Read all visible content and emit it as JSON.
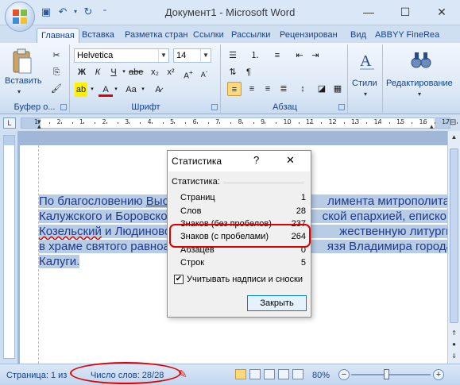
{
  "window": {
    "title": "Документ1 - Microsoft Word",
    "minimize_icon": "—",
    "maximize_icon": "☐",
    "close_icon": "✕"
  },
  "tabs": [
    {
      "label": "Главная",
      "active": true
    },
    {
      "label": "Вставка"
    },
    {
      "label": "Разметка стран"
    },
    {
      "label": "Ссылки"
    },
    {
      "label": "Рассылки"
    },
    {
      "label": "Рецензирован"
    },
    {
      "label": "Вид"
    },
    {
      "label": "ABBYY FineRea"
    }
  ],
  "ribbon": {
    "clipboard": {
      "paste_label": "Вставить",
      "group_label": "Буфер о..."
    },
    "font": {
      "name": "Helvetica",
      "size": "14",
      "group_label": "Шрифт"
    },
    "paragraph": {
      "group_label": "Абзац"
    },
    "styles": {
      "label": "Стили"
    },
    "editing": {
      "label": "Редактирование"
    }
  },
  "ruler": {
    "numbers": [
      "1",
      "2",
      "1",
      "2",
      "3",
      "4",
      "5",
      "6",
      "7",
      "8",
      "9",
      "10",
      "11",
      "12",
      "13",
      "14",
      "15",
      "16",
      "17"
    ]
  },
  "document": {
    "lines": [
      {
        "hl": "По благословению ",
        "u": "Выс",
        "hidden": "",
        "r1": "лимента",
        "r2": " митрополита"
      },
      {
        "hl": "Калужского и Боровско",
        "u": "",
        "hidden": "",
        "r1": "ской епархией, ",
        "r2": "епископ"
      },
      {
        "hl": "",
        "u": "Козельский",
        "m": " и ",
        "u2": "Людиново",
        "r1": "жественную литургию"
      },
      {
        "hl": "в храме святого равноа",
        "u": "",
        "hidden": "",
        "r1": "язя Владимира город",
        "r2": ""
      },
      {
        "hl": "Калуги.",
        "u": "",
        "hidden": "",
        "r1": "",
        "r2": ""
      }
    ],
    "line_texts": [
      [
        "По благословению ",
        "Выс",
        "",
        "лимента митрополита"
      ],
      [
        "Калужского и Боровско",
        "",
        "",
        "ской епархией, епископ"
      ],
      [
        "",
        "Козельский",
        " и Людиново",
        "жественную литургию"
      ],
      [
        "в храме святого равноа",
        "",
        "",
        "язя Владимира города"
      ],
      [
        "Калуги.",
        "",
        "",
        ""
      ]
    ]
  },
  "dialog": {
    "title": "Статистика",
    "help": "?",
    "close": "✕",
    "section": "Статистика:",
    "rows": [
      {
        "label": "Страниц",
        "value": "1"
      },
      {
        "label": "Слов",
        "value": "28"
      },
      {
        "label": "Знаков (без пробелов)",
        "value": "237"
      },
      {
        "label": "Знаков (с пробелами)",
        "value": "264"
      },
      {
        "label": "Абзацев",
        "value": "0"
      },
      {
        "label": "Строк",
        "value": "5"
      }
    ],
    "checkbox_label": "Учитывать надписи и сноски",
    "checkbox_checked": true,
    "checkmark": "✔",
    "close_button": "Закрыть"
  },
  "status": {
    "page": "Страница: 1 из",
    "words": "Число слов: 28/28",
    "zoom": "80%",
    "zoom_value": 80
  },
  "colors": {
    "highlight_ring": "#e00000",
    "selection": "#b8cce6"
  }
}
